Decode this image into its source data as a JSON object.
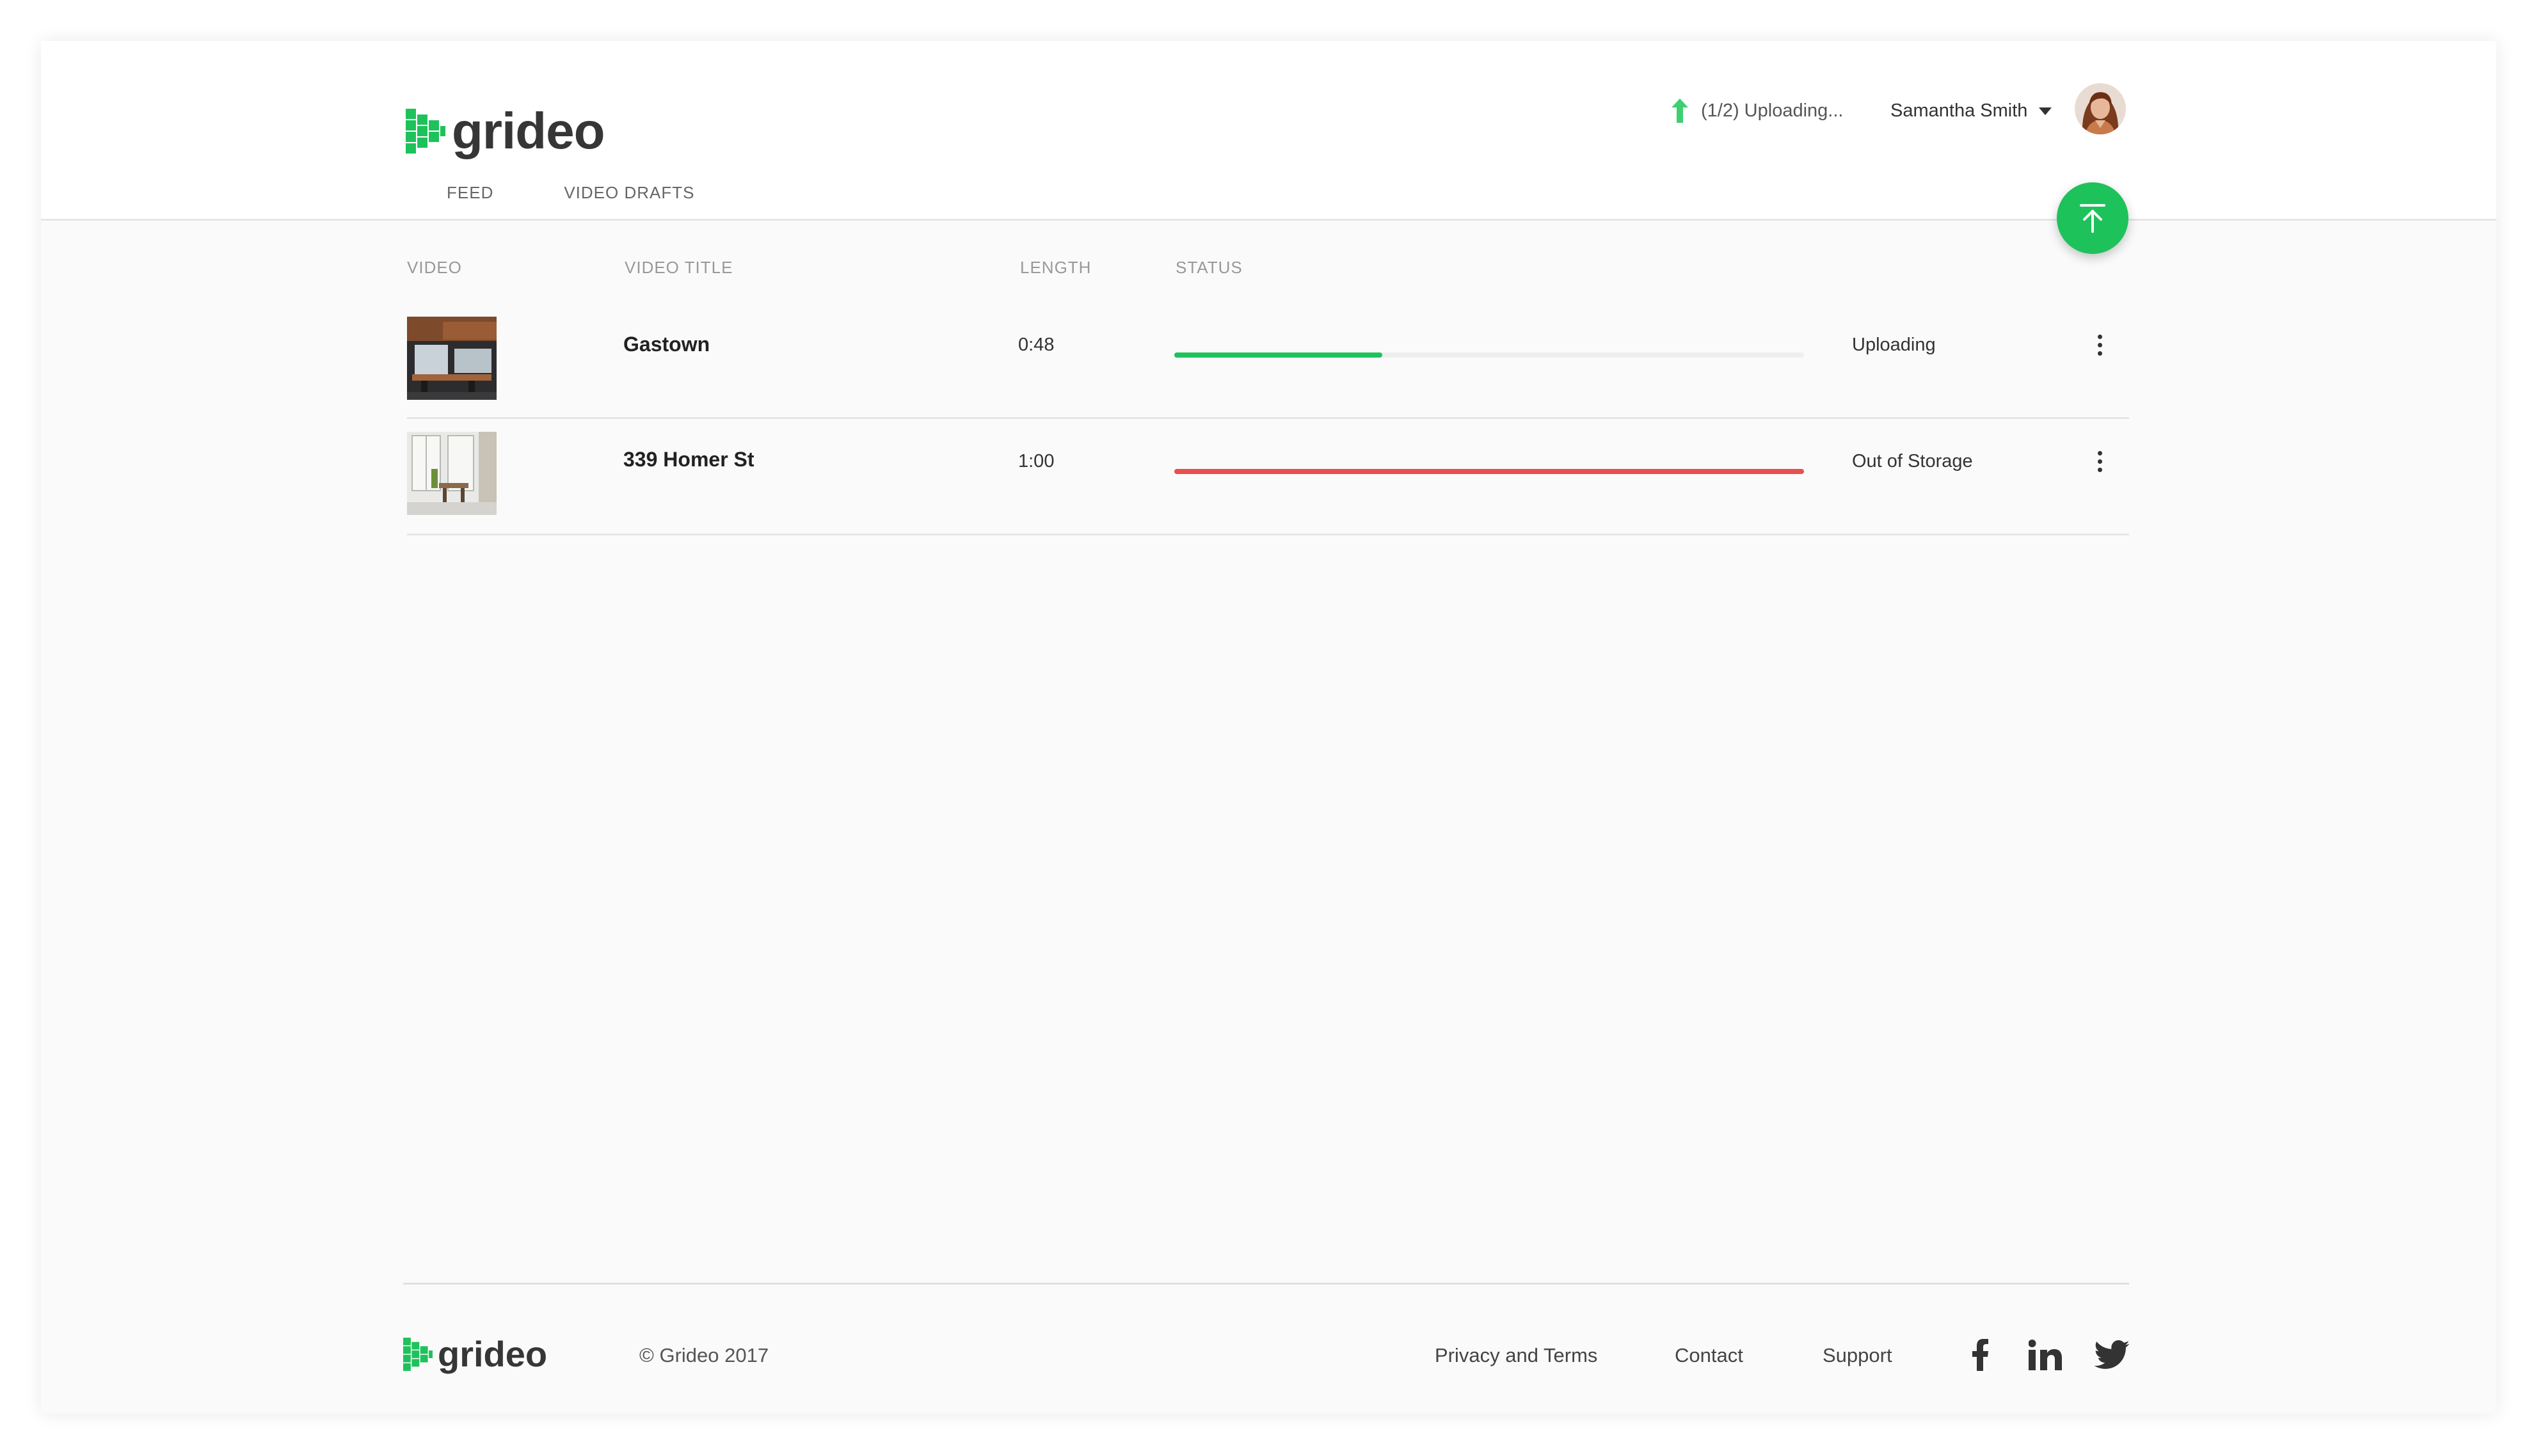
{
  "brand": {
    "name": "grideo",
    "accent": "#1ec25b",
    "danger": "#e94f4f"
  },
  "nav": {
    "items": [
      {
        "label": "FEED"
      },
      {
        "label": "VIDEO DRAFTS"
      }
    ]
  },
  "upload": {
    "status": "(1/2) Uploading..."
  },
  "user": {
    "name": "Samantha Smith"
  },
  "table": {
    "columns": [
      "VIDEO",
      "VIDEO TITLE",
      "LENGTH",
      "STATUS"
    ],
    "rows": [
      {
        "title": "Gastown",
        "length": "0:48",
        "status": "Uploading",
        "progress": 0.33,
        "bar_color": "#1ec25b"
      },
      {
        "title": "339 Homer St",
        "length": "1:00",
        "status": "Out of Storage",
        "progress": 1.0,
        "bar_color": "#e94f4f"
      }
    ]
  },
  "footer": {
    "brand": "grideo",
    "copyright": "© Grideo 2017",
    "links": [
      "Privacy and Terms",
      "Contact",
      "Support"
    ],
    "social_icons": [
      "facebook-icon",
      "linkedin-icon",
      "twitter-icon"
    ]
  }
}
